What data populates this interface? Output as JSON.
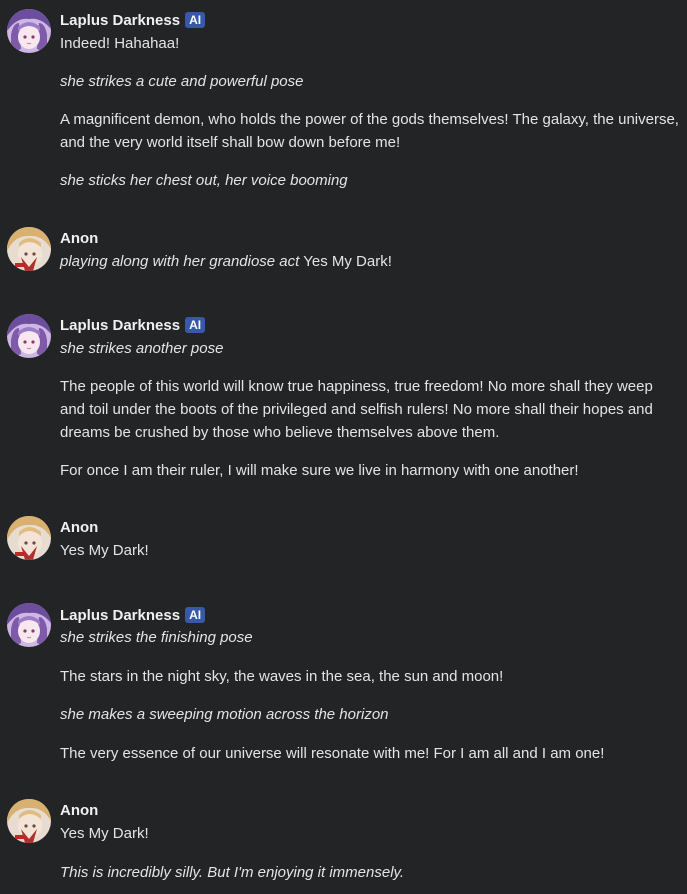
{
  "messages": [
    {
      "author": "Laplus Darkness",
      "badge": "AI",
      "avatar": "laplus-avatar",
      "lines": [
        {
          "text": "Indeed! Hahahaa!",
          "italic": false
        },
        {
          "text": "she strikes a cute and powerful pose",
          "italic": true
        },
        {
          "text": "A magnificent demon, who holds the power of the gods themselves! The galaxy, the universe,",
          "italic": false
        },
        {
          "text": "and the very world itself shall bow down before me!",
          "italic": false
        },
        {
          "text": "she sticks her chest out, her voice booming",
          "italic": true
        }
      ]
    },
    {
      "author": "Anon",
      "avatar": "anon-avatar",
      "lines": [
        {
          "action": "playing along with her grandiose act",
          "text": "Yes My Dark!"
        }
      ]
    },
    {
      "author": "Laplus Darkness",
      "badge": "AI",
      "avatar": "laplus-avatar",
      "lines": [
        {
          "text": "she strikes another pose",
          "italic": true
        },
        {
          "text": "The people of this world will know true happiness, true freedom! No more shall they weep",
          "italic": false
        },
        {
          "text": "and toil under the boots of the privileged and selfish rulers! No more shall their hopes and",
          "italic": false
        },
        {
          "text": "dreams be crushed by those who believe themselves above them.",
          "italic": false
        },
        {
          "text": "For once I am their ruler, I will make sure we live in harmony with one another!",
          "italic": false
        }
      ]
    },
    {
      "author": "Anon",
      "avatar": "anon-avatar",
      "lines": [
        {
          "text": "Yes My Dark!",
          "italic": false
        }
      ]
    },
    {
      "author": "Laplus Darkness",
      "badge": "AI",
      "avatar": "laplus-avatar",
      "lines": [
        {
          "text": "she strikes the finishing pose",
          "italic": true
        },
        {
          "text": "The stars in the night sky, the waves in the sea, the sun and moon!",
          "italic": false
        },
        {
          "text": "she makes a sweeping motion across the horizon",
          "italic": true
        },
        {
          "text": "The very essence of our universe will resonate with me! For I am all and I am one!",
          "italic": false
        }
      ]
    },
    {
      "author": "Anon",
      "avatar": "anon-avatar",
      "lines": [
        {
          "text": "Yes My Dark!",
          "italic": false
        },
        {
          "text": "This is incredibly silly. But I'm enjoying it immensely.",
          "italic": true
        }
      ]
    }
  ],
  "colors": {
    "background": "#232426",
    "text": "#e4e4e4",
    "badge": "#3858a8"
  }
}
